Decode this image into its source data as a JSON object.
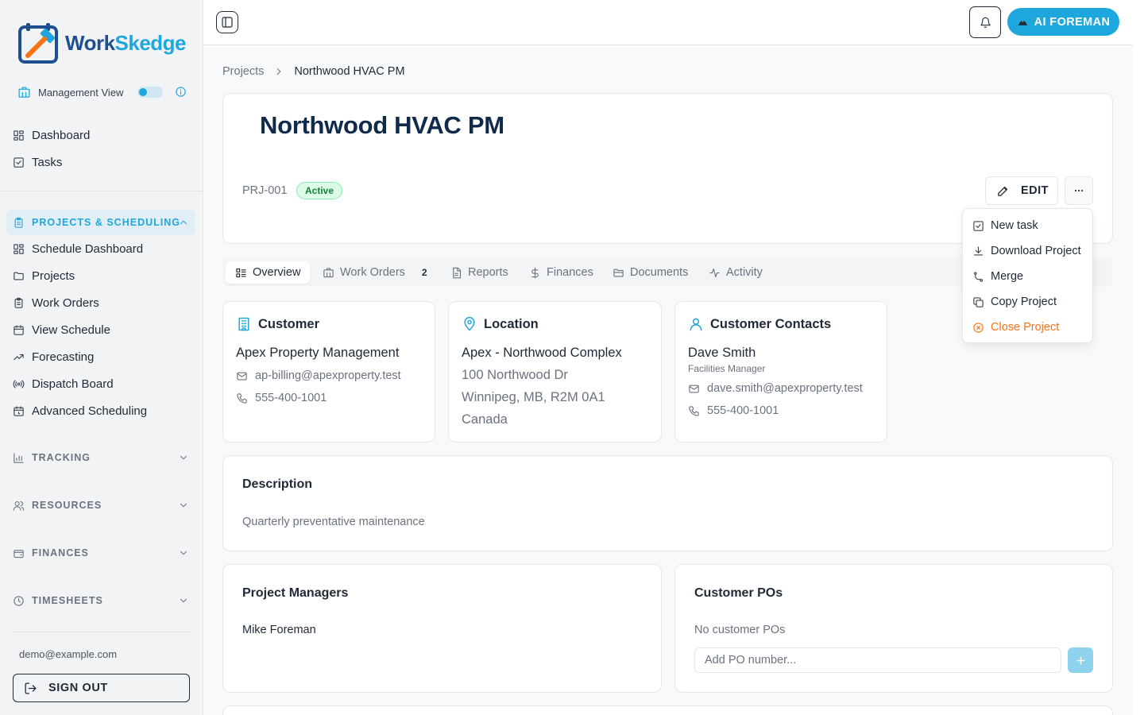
{
  "brand": {
    "name_part1": "Work",
    "name_part2": "Skedge",
    "accent": "#1ea7dc",
    "dark": "#1d4f91"
  },
  "sidebar": {
    "management_view_label": "Management View",
    "management_view_on": true,
    "top_items": [
      {
        "label": "Dashboard",
        "icon": "grid-icon"
      },
      {
        "label": "Tasks",
        "icon": "checkbox-icon"
      }
    ],
    "projects_section": {
      "title": "PROJECTS & SCHEDULING",
      "expanded": true,
      "items": [
        {
          "label": "Schedule Dashboard",
          "icon": "grid-icon"
        },
        {
          "label": "Projects",
          "icon": "folder-icon"
        },
        {
          "label": "Work Orders",
          "icon": "clipboard-icon"
        },
        {
          "label": "View Schedule",
          "icon": "calendar-icon"
        },
        {
          "label": "Forecasting",
          "icon": "trending-up-icon"
        },
        {
          "label": "Dispatch Board",
          "icon": "radio-icon"
        },
        {
          "label": "Advanced Scheduling",
          "icon": "calendar-clock-icon"
        }
      ]
    },
    "sections": [
      {
        "title": "TRACKING",
        "icon": "bar-chart-icon"
      },
      {
        "title": "RESOURCES",
        "icon": "users-icon"
      },
      {
        "title": "FINANCES",
        "icon": "wallet-icon"
      },
      {
        "title": "TIMESHEETS",
        "icon": "clock-icon"
      }
    ],
    "user_email": "demo@example.com",
    "sign_out_label": "SIGN OUT"
  },
  "topbar": {
    "ai_button_label": "AI FOREMAN"
  },
  "breadcrumb": {
    "parent": "Projects",
    "current": "Northwood HVAC PM"
  },
  "project": {
    "title": "Northwood HVAC PM",
    "id": "PRJ-001",
    "status": "Active",
    "edit_label": "EDIT"
  },
  "menu": {
    "items": [
      {
        "label": "New task",
        "icon": "checkbox-icon"
      },
      {
        "label": "Download Project",
        "icon": "download-icon"
      },
      {
        "label": "Merge",
        "icon": "merge-icon"
      },
      {
        "label": "Copy Project",
        "icon": "copy-icon"
      },
      {
        "label": "Close Project",
        "icon": "x-circle-icon",
        "danger": true
      }
    ]
  },
  "tabs": [
    {
      "label": "Overview",
      "icon": "list-icon",
      "active": true
    },
    {
      "label": "Work Orders",
      "icon": "building-icon",
      "count": "2"
    },
    {
      "label": "Reports",
      "icon": "file-icon"
    },
    {
      "label": "Finances",
      "icon": "dollar-icon"
    },
    {
      "label": "Documents",
      "icon": "folder-open-icon"
    },
    {
      "label": "Activity",
      "icon": "activity-icon"
    }
  ],
  "customer": {
    "title": "Customer",
    "name": "Apex Property Management",
    "email": "ap-billing@apexproperty.test",
    "phone": "555-400-1001"
  },
  "location": {
    "title": "Location",
    "name": "Apex - Northwood Complex",
    "line1": "100 Northwood Dr",
    "line2": "Winnipeg, MB, R2M 0A1",
    "line3": "Canada"
  },
  "contacts": {
    "title": "Customer Contacts",
    "name": "Dave Smith",
    "role": "Facilities Manager",
    "email": "dave.smith@apexproperty.test",
    "phone": "555-400-1001"
  },
  "description": {
    "title": "Description",
    "text": "Quarterly preventative maintenance"
  },
  "project_managers": {
    "title": "Project Managers",
    "names": [
      "Mike Foreman"
    ]
  },
  "customer_pos": {
    "title": "Customer POs",
    "empty_text": "No customer POs",
    "input_placeholder": "Add PO number..."
  }
}
